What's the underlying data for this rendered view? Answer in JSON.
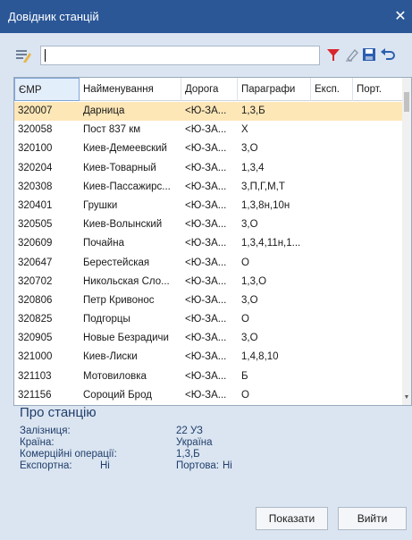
{
  "window": {
    "title": "Довідник станцій",
    "close_glyph": "✕"
  },
  "toolbar": {
    "search_value": "",
    "icons": [
      "edit-list-icon",
      "filter-icon",
      "clear-filter-icon",
      "save-icon",
      "undo-icon"
    ],
    "accent_colors": {
      "filter": "#d9262c",
      "save": "#2c5fb0"
    }
  },
  "grid": {
    "columns": [
      "ЄМР",
      "Найменування",
      "Дорога",
      "Параграфи",
      "Експ.",
      "Порт."
    ],
    "sorted_column": "ЄМР",
    "selected_row": 0,
    "rows": [
      [
        "320007",
        "Дарница",
        "<Ю-ЗА...",
        "1,3,Б",
        "",
        ""
      ],
      [
        "320058",
        "Пост 837 км",
        "<Ю-ЗА...",
        "Х",
        "",
        ""
      ],
      [
        "320100",
        "Киев-Демеевский",
        "<Ю-ЗА...",
        "3,О",
        "",
        ""
      ],
      [
        "320204",
        "Киев-Товарный",
        "<Ю-ЗА...",
        "1,3,4",
        "",
        ""
      ],
      [
        "320308",
        "Киев-Пассажирс...",
        "<Ю-ЗА...",
        "3,П,Г,М,Т",
        "",
        ""
      ],
      [
        "320401",
        "Грушки",
        "<Ю-ЗА...",
        "1,3,8н,10н",
        "",
        ""
      ],
      [
        "320505",
        "Киев-Волынский",
        "<Ю-ЗА...",
        "3,О",
        "",
        ""
      ],
      [
        "320609",
        "Почайна",
        "<Ю-ЗА...",
        "1,3,4,11н,1...",
        "",
        ""
      ],
      [
        "320647",
        "Берестейская",
        "<Ю-ЗА...",
        "О",
        "",
        ""
      ],
      [
        "320702",
        "Никольская Сло...",
        "<Ю-ЗА...",
        "1,3,О",
        "",
        ""
      ],
      [
        "320806",
        "Петр Кривонос",
        "<Ю-ЗА...",
        "3,О",
        "",
        ""
      ],
      [
        "320825",
        "Подгорцы",
        "<Ю-ЗА...",
        "О",
        "",
        ""
      ],
      [
        "320905",
        "Новые Безрадичи",
        "<Ю-ЗА...",
        "3,О",
        "",
        ""
      ],
      [
        "321000",
        "Киев-Лиски",
        "<Ю-ЗА...",
        "1,4,8,10",
        "",
        ""
      ],
      [
        "321103",
        "Мотовиловка",
        "<Ю-ЗА...",
        "Б",
        "",
        ""
      ],
      [
        "321156",
        "Сороций Брод",
        "<Ю-ЗА...",
        "О",
        "",
        ""
      ]
    ]
  },
  "about": {
    "title": "Про станцію",
    "railway_label": "Залізниця:",
    "railway_value": "22 УЗ",
    "country_label": "Країна:",
    "country_value": "Україна",
    "commercial_label": "Комерційні операції:",
    "commercial_value": "1,3,Б",
    "export_label": "Експортна:",
    "export_value": "Ні",
    "port_label": "Портова:",
    "port_value": "Ні"
  },
  "buttons": {
    "show": "Показати",
    "exit": "Вийти"
  }
}
